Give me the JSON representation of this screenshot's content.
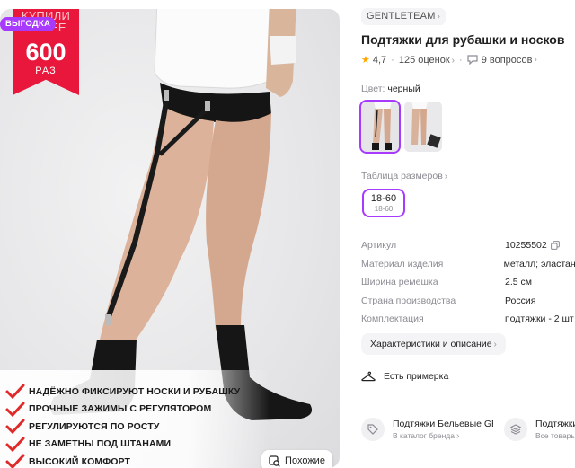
{
  "gallery": {
    "promo": {
      "top_text": "КУПИЛИ БОЛЕЕ",
      "number": "600",
      "unit": "РАЗ",
      "color": "#e8173b"
    },
    "badge": "ВЫГОДКА",
    "benefits": [
      "НАДЁЖНО ФИКСИРУЮТ НОСКИ И РУБАШКУ",
      "ПРОЧНЫЕ ЗАЖИМЫ С РЕГУЛЯТОРОМ",
      "РЕГУЛИРУЮТСЯ ПО РОСТУ",
      "НЕ ЗАМЕТНЫ ПОД ШТАНАМИ",
      "ВЫСОКИЙ КОМФОРТ"
    ],
    "similar_button": "Похожие"
  },
  "product": {
    "brand": "GENTLETEAM",
    "title": "Подтяжки для рубашки и носков",
    "rating": "4,7",
    "reviews": "125 оценок",
    "questions": "9 вопросов",
    "color_label": "Цвет:",
    "color_value": "черный",
    "size_table_label": "Таблица размеров",
    "size": {
      "main": "18-60",
      "sub": "18-60"
    },
    "specs": [
      {
        "key": "Артикул",
        "value": "10255502"
      },
      {
        "key": "Материал изделия",
        "value": "металл; эластан"
      },
      {
        "key": "Ширина ремешка",
        "value": "2.5 см"
      },
      {
        "key": "Страна производства",
        "value": "Россия"
      },
      {
        "key": "Комплектация",
        "value": "подтяжки - 2 шт"
      }
    ],
    "details_button": "Характеристики и описание",
    "fitting_label": "Есть примерка"
  },
  "cards": [
    {
      "title": "Подтяжки Бельевые GENTLETEAM",
      "sub": "В каталог бренда",
      "icon": "tag-icon"
    },
    {
      "title": "Подтяжки",
      "sub": "Все товары",
      "icon": "layers-icon"
    }
  ],
  "colors": {
    "accent": "#a73afd",
    "promo": "#e8173b",
    "check": "#e02a2a",
    "star": "#ffa600"
  }
}
